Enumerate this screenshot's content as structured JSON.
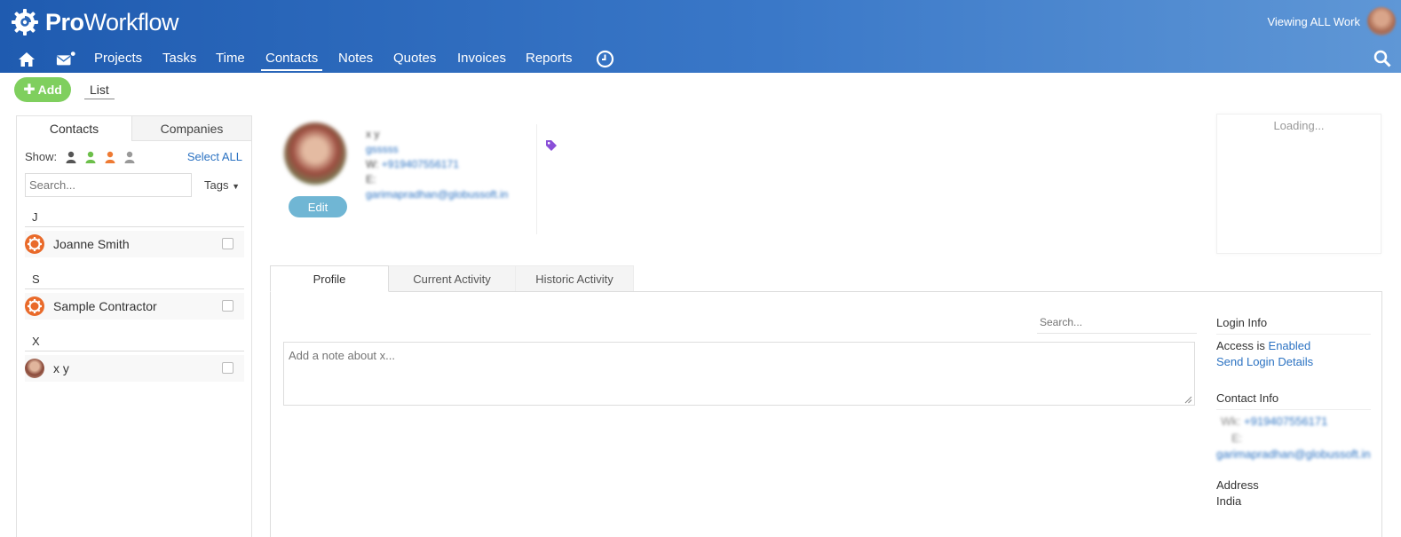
{
  "header": {
    "logo_bold": "Pro",
    "logo_light": "Workflow",
    "viewing": "Viewing ALL Work"
  },
  "nav": {
    "items": [
      {
        "label": "Projects"
      },
      {
        "label": "Tasks"
      },
      {
        "label": "Time"
      },
      {
        "label": "Contacts",
        "active": true
      },
      {
        "label": "Notes"
      },
      {
        "label": "Quotes"
      },
      {
        "label": "Invoices"
      },
      {
        "label": "Reports"
      }
    ]
  },
  "toolbar": {
    "add_label": "Add",
    "list_label": "List"
  },
  "left": {
    "tabs": [
      "Contacts",
      "Companies"
    ],
    "show_label": "Show:",
    "select_all": "Select ALL",
    "search_placeholder": "Search...",
    "tags_label": "Tags",
    "groups": [
      {
        "letter": "J",
        "contacts": [
          {
            "name": "Joanne Smith",
            "icon": "contractor-icon"
          }
        ]
      },
      {
        "letter": "S",
        "contacts": [
          {
            "name": "Sample Contractor",
            "icon": "contractor-icon"
          }
        ]
      },
      {
        "letter": "X",
        "contacts": [
          {
            "name": "x y",
            "icon": "avatar-photo"
          }
        ]
      }
    ]
  },
  "profile": {
    "name": "x y",
    "company": "gsssss",
    "work_label": "W:",
    "work_phone": "+919407556171",
    "email_label": "E:",
    "email": "garimapradhan@globussoft.in",
    "edit_label": "Edit",
    "loading": "Loading..."
  },
  "main": {
    "tabs": [
      "Profile",
      "Current Activity",
      "Historic Activity"
    ],
    "search_placeholder": "Search...",
    "note_placeholder": "Add a note about x..."
  },
  "sidebar": {
    "login_heading": "Login Info",
    "access_prefix": "Access is",
    "access_status": "Enabled",
    "send_login": "Send Login Details",
    "contact_heading": "Contact Info",
    "work_label": "Wk:",
    "work_phone": "+919407556171",
    "email_label": "E:",
    "email": "garimapradhan@globussoft.in",
    "address_heading": "Address",
    "address": "India"
  },
  "colors": {
    "header_dark": "#1f5bb0",
    "header_light": "#5f97d6",
    "add_green": "#7fcf5e",
    "edit_blue": "#70b6d4",
    "link_blue": "#2b72c2",
    "contractor_orange": "#e96a2a",
    "tag_purple": "#8a4fd8"
  }
}
